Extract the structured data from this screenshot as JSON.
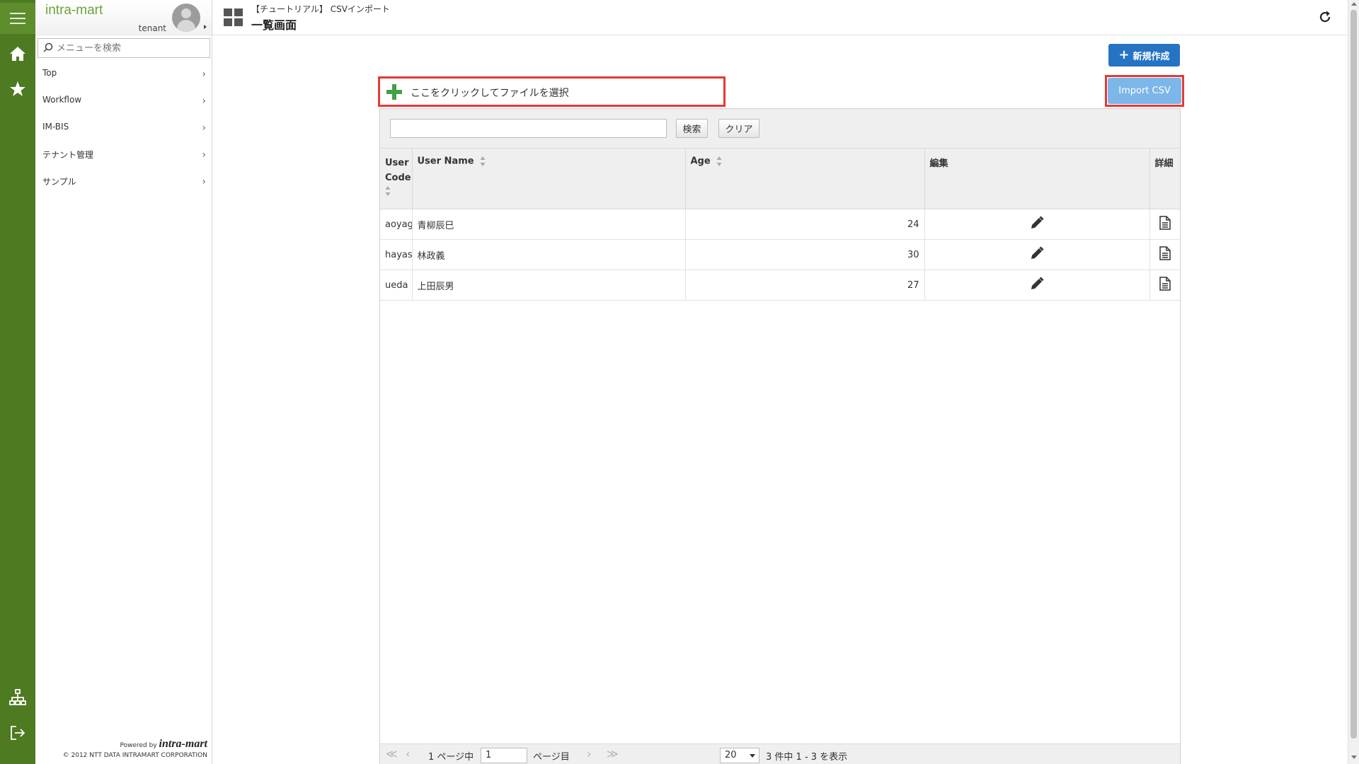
{
  "app": {
    "logo": "intra-mart",
    "tenant": "tenant"
  },
  "menu": {
    "search_placeholder": "メニューを検索",
    "items": [
      {
        "label": "Top"
      },
      {
        "label": "Workflow"
      },
      {
        "label": "IM-BIS"
      },
      {
        "label": "テナント管理"
      },
      {
        "label": "サンプル"
      }
    ],
    "powered_by": "Powered by",
    "powered_brand": "intra-mart",
    "copyright": "© 2012 NTT DATA INTRAMART CORPORATION"
  },
  "header": {
    "breadcrumb": "【チュートリアル】 CSVインポート",
    "title": "一覧画面"
  },
  "actions": {
    "new_label": "新規作成",
    "import_label": "Import CSV",
    "file_select_label": "ここをクリックしてファイルを選択"
  },
  "toolbar": {
    "search_value": "",
    "search_button": "検索",
    "clear_button": "クリア"
  },
  "table": {
    "columns": [
      "User Code",
      "User Name",
      "Age",
      "編集",
      "詳細"
    ],
    "rows": [
      {
        "code": "aoyagi",
        "name": "青柳辰巳",
        "age": "24"
      },
      {
        "code": "hayashi",
        "name": "林政義",
        "age": "30"
      },
      {
        "code": "ueda",
        "name": "上田辰男",
        "age": "27"
      }
    ]
  },
  "pager": {
    "page_of": "1 ページ中",
    "page_value": "1",
    "page_suffix": "ページ目",
    "page_size": "20",
    "summary": "3 件中 1 - 3 を表示"
  },
  "colors": {
    "rail": "#4e7a22",
    "primary": "#2673c4",
    "import": "#7db6e8",
    "highlight": "#e53935",
    "logo": "#6aa63b"
  }
}
